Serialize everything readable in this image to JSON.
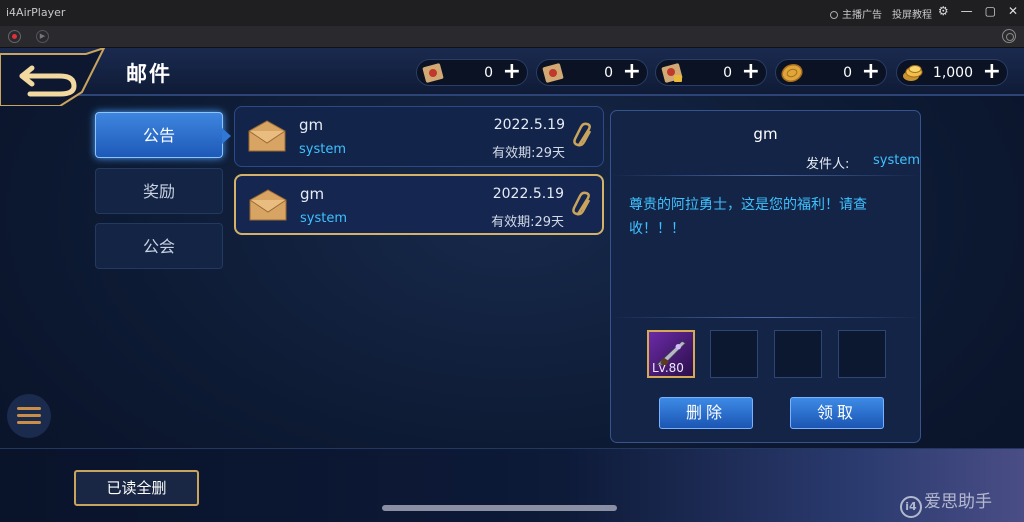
{
  "window": {
    "app_name": "i4AirPlayer",
    "links": [
      "主播广告",
      "投屏教程"
    ],
    "buttons": [
      "⚙",
      "—",
      "▢",
      "✕"
    ]
  },
  "header": {
    "title": "邮件",
    "currencies": [
      {
        "icon": "scroll-icon",
        "value": "0"
      },
      {
        "icon": "scroll-icon",
        "value": "0"
      },
      {
        "icon": "locked-scroll-icon",
        "value": "0"
      },
      {
        "icon": "coin-icon",
        "value": "0"
      },
      {
        "icon": "gold-coins-icon",
        "value": "1,000"
      }
    ],
    "plus_label": "+"
  },
  "tabs": [
    {
      "label": "公告",
      "active": true
    },
    {
      "label": "奖励",
      "active": false
    },
    {
      "label": "公会",
      "active": false
    }
  ],
  "mails": [
    {
      "sender": "gm",
      "type": "system",
      "date": "2022.5.19",
      "expire": "有效期:29天",
      "selected": false
    },
    {
      "sender": "gm",
      "type": "system",
      "date": "2022.5.19",
      "expire": "有效期:29天",
      "selected": true
    }
  ],
  "detail": {
    "title": "gm",
    "sender_label": "发件人:",
    "sender": "system",
    "body": "尊贵的阿拉勇士，这是您的福利！请查收！！！",
    "attachment": {
      "level_label": "Lv.80",
      "icon": "rifle-icon"
    },
    "delete_label": "删除",
    "claim_label": "领取"
  },
  "footer": {
    "delete_read_label": "已读全删",
    "watermark": "爱思助手",
    "watermark_logo": "i4"
  },
  "colors": {
    "accent_blue": "#3ec1ff",
    "gold_border": "#d4b26a",
    "button_blue": "#1e59b8"
  }
}
